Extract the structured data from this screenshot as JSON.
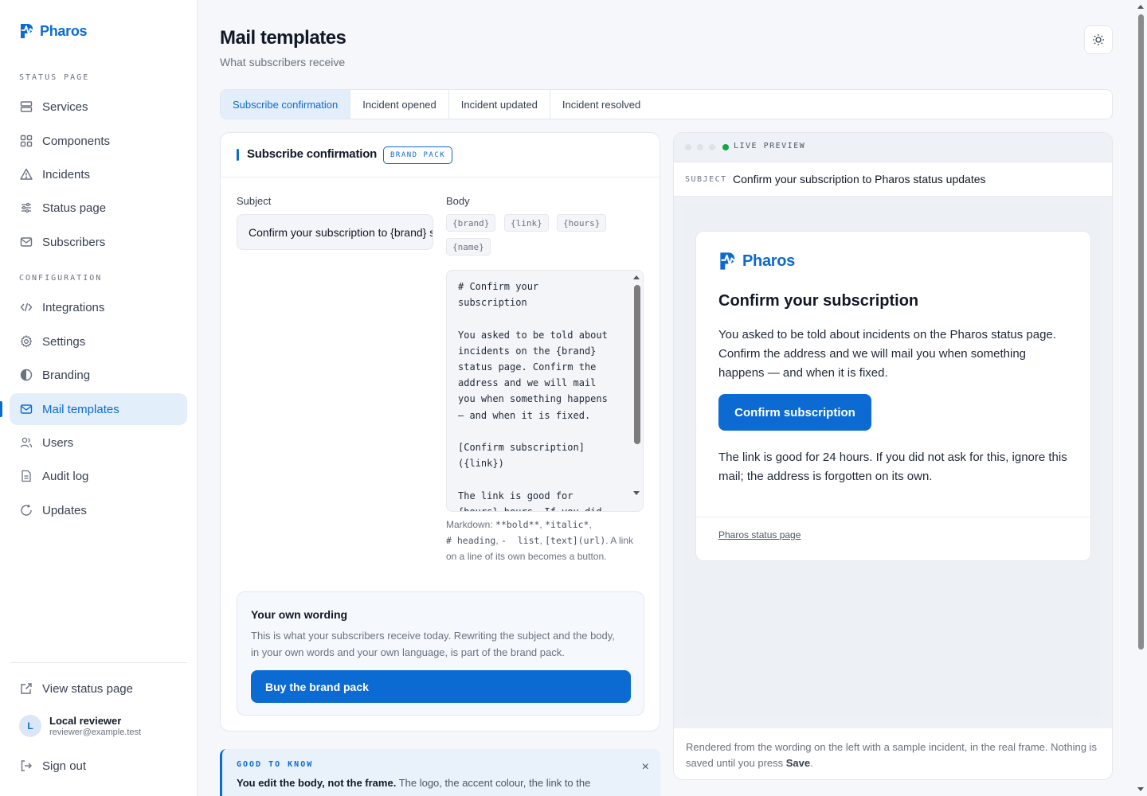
{
  "brand": {
    "name": "Pharos",
    "color": "#0b6bd3"
  },
  "sidebar": {
    "section_status": "STATUS PAGE",
    "section_config": "CONFIGURATION",
    "items": [
      {
        "label": "Services",
        "icon": "server-icon"
      },
      {
        "label": "Components",
        "icon": "grid-icon"
      },
      {
        "label": "Incidents",
        "icon": "warning-icon"
      },
      {
        "label": "Status page",
        "icon": "sliders-icon"
      },
      {
        "label": "Subscribers",
        "icon": "mail-icon"
      },
      {
        "label": "Integrations",
        "icon": "code-icon"
      },
      {
        "label": "Settings",
        "icon": "gear-icon"
      },
      {
        "label": "Branding",
        "icon": "contrast-icon"
      },
      {
        "label": "Mail templates",
        "icon": "mail-icon",
        "active": true
      },
      {
        "label": "Users",
        "icon": "users-icon"
      },
      {
        "label": "Audit log",
        "icon": "file-icon"
      },
      {
        "label": "Updates",
        "icon": "refresh-icon"
      }
    ],
    "view_status": "View status page",
    "user": {
      "initial": "L",
      "name": "Local reviewer",
      "email": "reviewer@example.test"
    },
    "sign_out": "Sign out"
  },
  "header": {
    "title": "Mail templates",
    "subtitle": "What subscribers receive"
  },
  "tabs": [
    {
      "label": "Subscribe confirmation",
      "active": true
    },
    {
      "label": "Incident opened"
    },
    {
      "label": "Incident updated"
    },
    {
      "label": "Incident resolved"
    }
  ],
  "editor": {
    "title": "Subscribe confirmation",
    "badge": "BRAND PACK",
    "subject_label": "Subject",
    "subject_value": "Confirm your subscription to {brand} status updates",
    "body_label": "Body",
    "chips": [
      "{brand}",
      "{link}",
      "{hours}",
      "{name}"
    ],
    "body_value": "# Confirm your\nsubscription\n\nYou asked to be told about\nincidents on the {brand}\nstatus page. Confirm the\naddress and we will mail\nyou when something happens\n— and when it is fixed.\n\n[Confirm subscription]\n({link})\n\nThe link is good for\n{hours} hours. If you did",
    "markdown_hint_prefix": "Markdown: ",
    "markdown_hint_codes": [
      "**bold**",
      "*italic*",
      "# heading",
      "-  list",
      "[text](url)"
    ],
    "markdown_hint_suffix": ". A link on a line of its own becomes a button.",
    "own_title": "Your own wording",
    "own_text": "This is what your subscribers receive today. Rewriting the subject and the body, in your own words and your own language, is part of the brand pack.",
    "buy_label": "Buy the brand pack"
  },
  "note": {
    "label": "GOOD TO KNOW",
    "bold": "You edit the body, not the frame.",
    "text": " The logo, the accent colour, the link to the",
    "close": "×"
  },
  "preview": {
    "live_label": "LIVE PREVIEW",
    "subject_tag": "SUBJECT",
    "subject_value": "Confirm your subscription to Pharos status updates",
    "mail_brand": "Pharos",
    "mail_heading": "Confirm your subscription",
    "mail_p1": "You asked to be told about incidents on the Pharos status page. Confirm the address and we will mail you when something happens — and when it is fixed.",
    "mail_button": "Confirm subscription",
    "mail_p2": "The link is good for 24 hours. If you did not ask for this, ignore this mail; the address is forgotten on its own.",
    "mail_footer_link": "Pharos status page",
    "foot_text": "Rendered from the wording on the left with a sample incident, in the real frame. Nothing is saved until you press ",
    "foot_bold": "Save",
    "foot_end": "."
  }
}
